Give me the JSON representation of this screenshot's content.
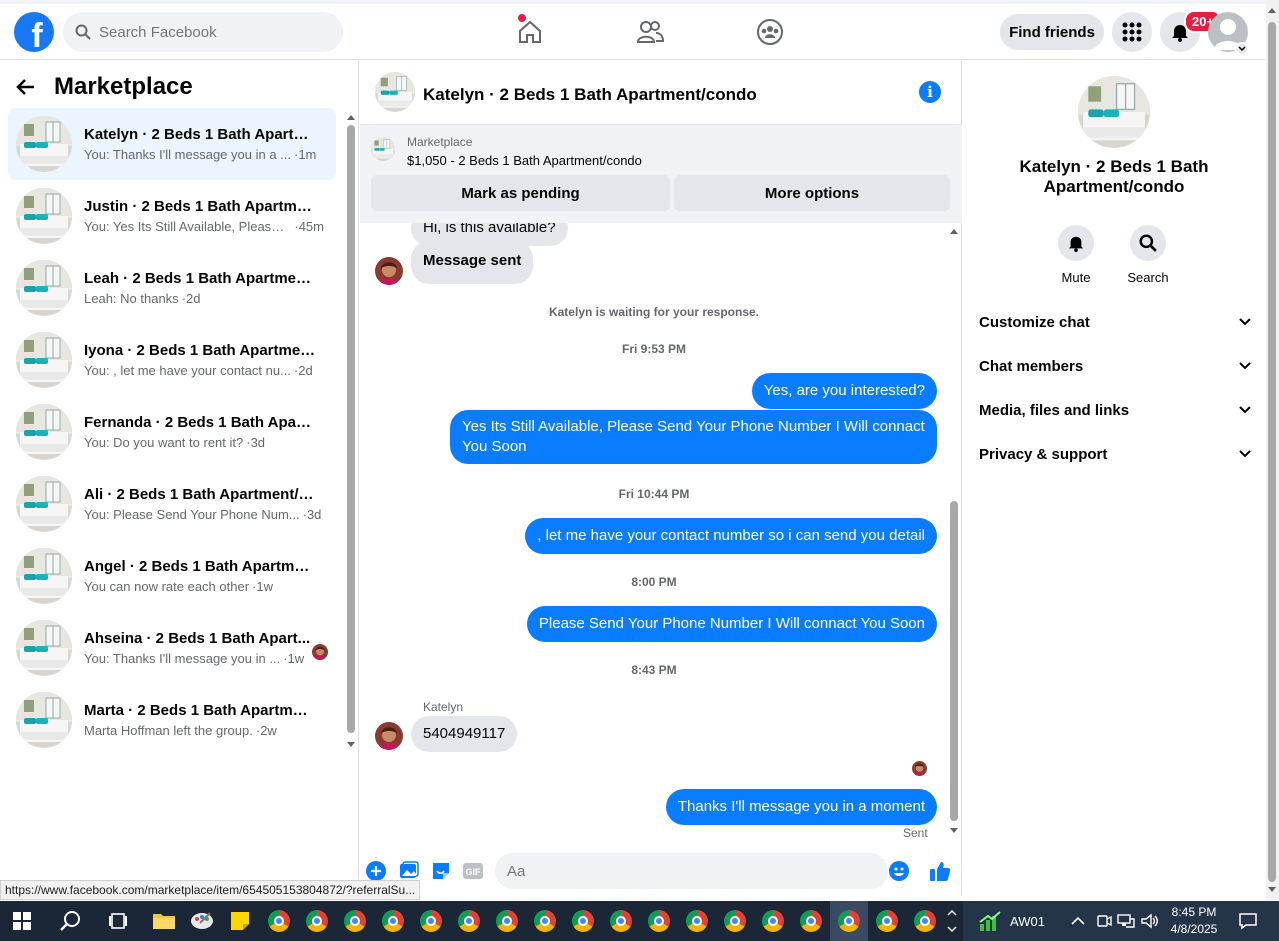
{
  "topnav": {
    "search_placeholder": "Search Facebook",
    "find_friends": "Find friends",
    "notifications_badge": "20+"
  },
  "left": {
    "title": "Marketplace",
    "conversations": [
      {
        "name": "Katelyn · 2 Beds 1 Bath Apartme...",
        "preview": "You: Thanks I'll message you in a ...",
        "time": "·1m",
        "active": true
      },
      {
        "name": "Justin · 2 Beds 1 Bath Apartment...",
        "preview": "You: Yes Its Still Available, Please ...",
        "time": "·45m"
      },
      {
        "name": "Leah · 2 Beds 1 Bath Apartment/...",
        "preview": "Leah: No thanks",
        "time": "·2d"
      },
      {
        "name": "Iyona · 2 Beds 1 Bath Apartment...",
        "preview": "You: , let me have your contact nu...",
        "time": "·2d"
      },
      {
        "name": "Fernanda · 2 Beds 1 Bath Apart...",
        "preview": "You: Do you want to rent it?",
        "time": "·3d"
      },
      {
        "name": "Ali · 2 Beds 1 Bath Apartment/co...",
        "preview": "You: Please Send Your Phone Num...",
        "time": "·3d"
      },
      {
        "name": "Angel · 2 Beds 1 Bath Apartment...",
        "preview": "You can now rate each other",
        "time": "·1w"
      },
      {
        "name": "Ahseina · 2 Beds 1 Bath Apart...",
        "preview": "You: Thanks I'll message you in ...",
        "time": "·1w"
      },
      {
        "name": "Marta · 2 Beds 1 Bath Apartmen...",
        "preview": "Marta Hoffman left the group.",
        "time": "·2w"
      }
    ]
  },
  "chat": {
    "title": "Katelyn · 2 Beds 1 Bath Apartment/condo",
    "marketplace_label": "Marketplace",
    "listing": "$1,050 - 2 Beds 1 Bath Apartment/condo",
    "mark_pending": "Mark as pending",
    "more_options": "More options",
    "first_msg_partial": "Hi, is this available?",
    "message_sent": "Message sent",
    "waiting": "Katelyn is waiting for your response.",
    "ts1": "Fri 9:53 PM",
    "out1": "Yes, are you interested?",
    "out2": "Yes Its Still Available, Please Send Your Phone Number I Will connact You Soon",
    "ts2": "Fri 10:44 PM",
    "out3": ", let me have your contact number so i can send you detail",
    "ts3": "8:00 PM",
    "out4": "Please Send Your Phone Number I Will connact You Soon",
    "ts4": "8:43 PM",
    "sender": "Katelyn",
    "in_phone": "5404949117",
    "out5": "Thanks I'll message you in a moment",
    "sent": "Sent",
    "composer_placeholder": "Aa"
  },
  "right": {
    "name": "Katelyn · 2 Beds 1 Bath Apartment/condo",
    "mute": "Mute",
    "search": "Search",
    "sections": [
      "Customize chat",
      "Chat members",
      "Media, files and links",
      "Privacy & support"
    ]
  },
  "status_url": "https://www.facebook.com/marketplace/item/654505153804872/?referralSu...",
  "taskbar": {
    "app_label": "AW01",
    "time": "8:45 PM",
    "date": "4/8/2025"
  },
  "colors": {
    "brand": "#1877f2",
    "messenger_blue": "#0a7cff",
    "badge_red": "#e41e3f"
  }
}
